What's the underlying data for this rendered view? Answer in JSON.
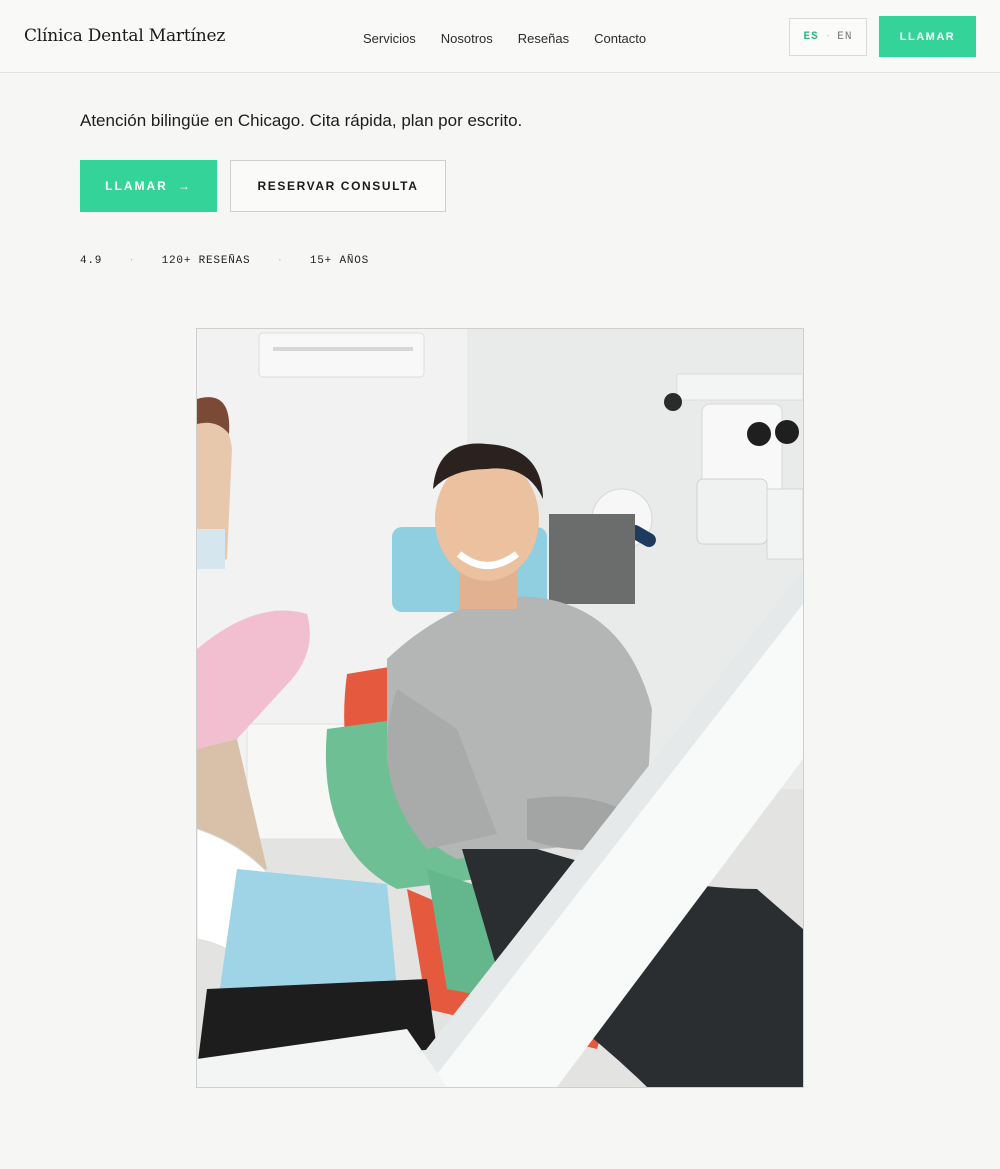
{
  "header": {
    "brand": "Clínica Dental Martínez",
    "nav": [
      "Servicios",
      "Nosotros",
      "Reseñas",
      "Contacto"
    ],
    "lang": {
      "active": "ES",
      "separator": "·",
      "inactive": "EN"
    },
    "call_label": "LLAMAR"
  },
  "hero": {
    "tagline": "Atención bilingüe en Chicago. Cita rápida, plan por escrito.",
    "primary_cta": {
      "label": "LLAMAR",
      "arrow": "→"
    },
    "secondary_cta": "RESERVAR CONSULTA",
    "stats": {
      "rating": "4.9",
      "reviews": "120+ RESEÑAS",
      "years": "15+ AÑOS",
      "separator": "·"
    }
  },
  "colors": {
    "accent": "#34d399",
    "background": "#f6f6f5",
    "text": "#1c1c1c"
  },
  "icons": {
    "cta_arrow": "arrow-right-icon"
  }
}
